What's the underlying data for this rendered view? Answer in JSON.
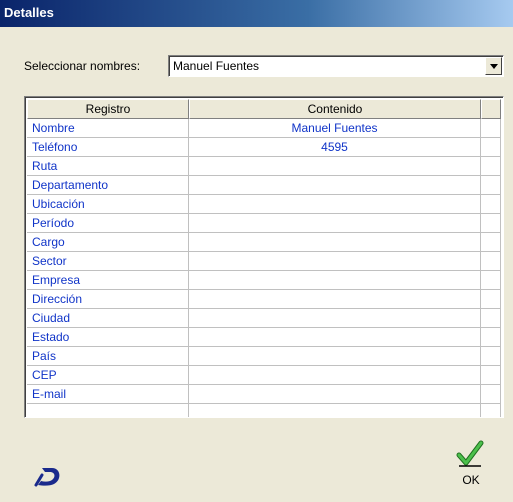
{
  "window": {
    "title": "Detalles"
  },
  "selector": {
    "label": "Seleccionar nombres:",
    "value": "Manuel Fuentes"
  },
  "table": {
    "columns": [
      "Registro",
      "Contenido",
      ""
    ],
    "rows": [
      [
        "Nombre",
        "Manuel Fuentes"
      ],
      [
        "Teléfono",
        "4595"
      ],
      [
        "Ruta",
        ""
      ],
      [
        "Departamento",
        ""
      ],
      [
        "Ubicación",
        ""
      ],
      [
        "Período",
        ""
      ],
      [
        "Cargo",
        ""
      ],
      [
        "Sector",
        ""
      ],
      [
        "Empresa",
        ""
      ],
      [
        "Dirección",
        ""
      ],
      [
        "Ciudad",
        ""
      ],
      [
        "Estado",
        ""
      ],
      [
        "País",
        ""
      ],
      [
        "CEP",
        ""
      ],
      [
        "E-mail",
        ""
      ],
      [
        "",
        ""
      ]
    ]
  },
  "footer": {
    "ok_label": "OK",
    "logo_icon": "app-logo-icon",
    "ok_icon": "checkmark-icon"
  },
  "colors": {
    "title_bar": "#0a246a",
    "cell_text": "#1034c8",
    "check": "#2e9a2e"
  }
}
